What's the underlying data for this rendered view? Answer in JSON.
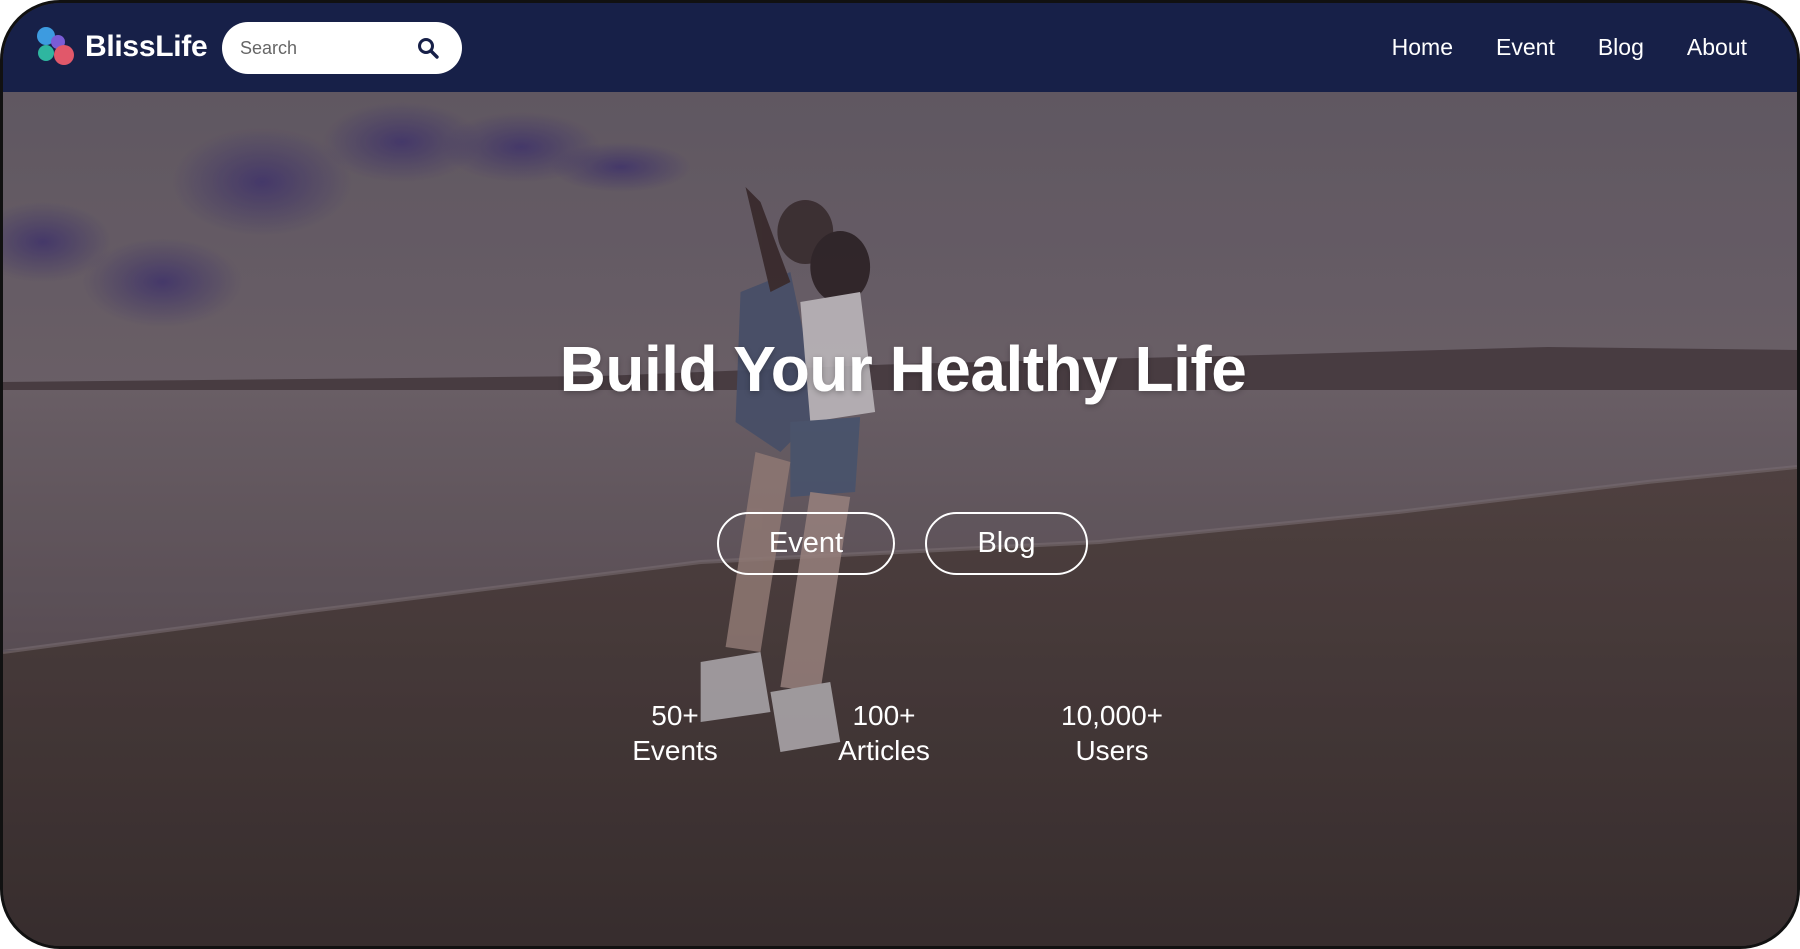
{
  "navbar": {
    "brand_name": "BlissLife",
    "search_placeholder": "Search",
    "links": [
      "Home",
      "Event",
      "Blog",
      "About"
    ]
  },
  "hero": {
    "title": "Build Your Healthy Life",
    "buttons": {
      "event": "Event",
      "blog": "Blog"
    },
    "stats": [
      {
        "value": "50+",
        "label": "Events"
      },
      {
        "value": "100+",
        "label": "Articles"
      },
      {
        "value": "10,000+",
        "label": "Users"
      }
    ]
  },
  "colors": {
    "navbar_bg": "#172048",
    "text": "#ffffff",
    "logo_dots": [
      "#3d9be0",
      "#2fb6a0",
      "#e1586a",
      "#7a5cd6"
    ]
  },
  "icons": {
    "logo": "four-dot-logo-icon",
    "search": "search-icon"
  }
}
